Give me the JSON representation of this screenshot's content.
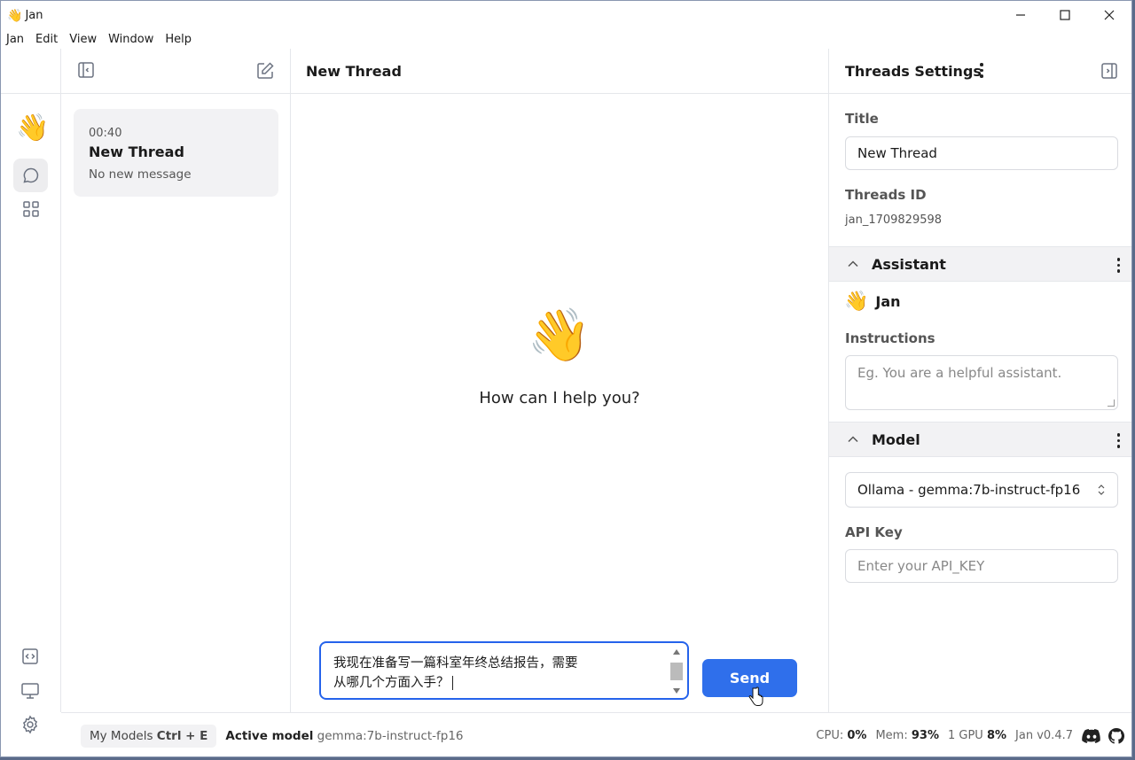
{
  "window": {
    "emoji": "👋",
    "title": "Jan"
  },
  "menu": [
    "Jan",
    "Edit",
    "View",
    "Window",
    "Help"
  ],
  "sidebar": {
    "thread": {
      "time": "00:40",
      "title": "New Thread",
      "subtitle": "No new message"
    }
  },
  "main": {
    "title": "New Thread",
    "greeting_emoji": "👋",
    "greeting": "How can I help you?",
    "composer_line1": "我现在准备写一篇科室年终总结报告，需要",
    "composer_line2": "从哪几个方面入手？",
    "send_label": "Send"
  },
  "settings": {
    "header": "Threads Settings",
    "title_label": "Title",
    "title_value": "New Thread",
    "id_label": "Threads ID",
    "id_value": "jan_1709829598",
    "assistant_section": "Assistant",
    "assistant_emoji": "👋",
    "assistant_name": "Jan",
    "instructions_label": "Instructions",
    "instructions_placeholder": "Eg. You are a helpful assistant.",
    "model_section": "Model",
    "model_value": "Ollama - gemma:7b-instruct-fp16",
    "api_key_label": "API Key",
    "api_key_placeholder": "Enter your API_KEY"
  },
  "status": {
    "my_models": "My Models",
    "shortcut": "Ctrl + E",
    "active_model_label": "Active model",
    "active_model_value": "gemma:7b-instruct-fp16",
    "cpu_label": "CPU:",
    "cpu_value": "0%",
    "mem_label": "Mem:",
    "mem_value": "93%",
    "gpu_label": "1 GPU",
    "gpu_value": "8%",
    "version": "Jan v0.4.7"
  },
  "colors": {
    "accent": "#2f6feb",
    "border": "#e5e7eb",
    "panel_bg": "#f2f2f4"
  }
}
